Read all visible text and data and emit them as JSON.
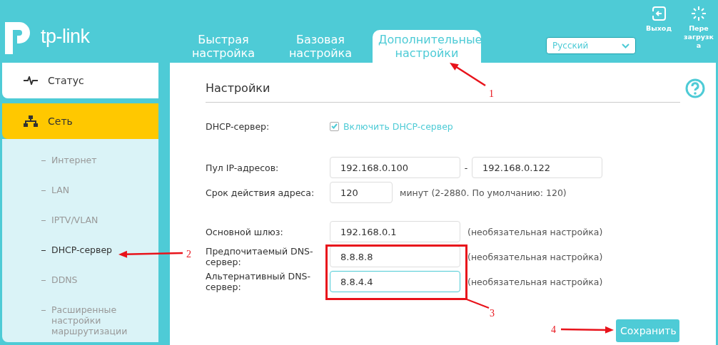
{
  "header": {
    "logo_text": "tp-link",
    "tabs": [
      {
        "label": "Быстрая настройка",
        "selected": false
      },
      {
        "label": "Базовая настройка",
        "selected": false
      },
      {
        "label": "Дополнительные настройки",
        "selected": true
      }
    ],
    "language": {
      "value": "Русский"
    },
    "actions": [
      {
        "kind": "logout",
        "label": "Выход"
      },
      {
        "kind": "reboot",
        "label": "Пере загрузк а"
      }
    ]
  },
  "sidebar": {
    "items": [
      {
        "kind": "status",
        "label": "Статус",
        "selected": false
      },
      {
        "kind": "network",
        "label": "Сеть",
        "selected": true,
        "expanded": true,
        "children": [
          {
            "label": "Интернет",
            "selected": false
          },
          {
            "label": "LAN",
            "selected": false
          },
          {
            "label": "IPTV/VLAN",
            "selected": false
          },
          {
            "label": "DHCP-сервер",
            "selected": true
          },
          {
            "label": "DDNS",
            "selected": false
          },
          {
            "label": "Расширенные настройки маршрутизации",
            "selected": false
          }
        ]
      }
    ]
  },
  "section": {
    "title": "Настройки",
    "rows": [
      {
        "kind": "checkbox",
        "label": "DHCP-сервер:",
        "option": "Включить DHCP-сервер",
        "checked": true
      },
      {
        "kind": "range",
        "label": "Пул IP-адресов:",
        "from": "192.168.0.100",
        "separator": "-",
        "to": "192.168.0.122"
      },
      {
        "kind": "input",
        "label": "Срок действия адреса:",
        "value": "120",
        "short": true,
        "focused": false,
        "note": "минут (2-2880. По умолчанию: 120)"
      },
      {
        "kind": "input",
        "label": "Основной шлюз:",
        "value": "192.168.0.1",
        "note": "(необязательная настройка)",
        "focused": false
      },
      {
        "kind": "input",
        "label": "Предпочитаемый DNS-сервер:",
        "value": "8.8.8.8",
        "note": "(необязательная настройка)",
        "focused": false
      },
      {
        "kind": "input",
        "label": "Альтернативный DNS-сервер:",
        "value": "8.8.4.4",
        "note": "(необязательная настройка)",
        "focused": true
      }
    ],
    "save_button": "Сохранить"
  },
  "annotations": [
    "1",
    "2",
    "3",
    "4"
  ]
}
